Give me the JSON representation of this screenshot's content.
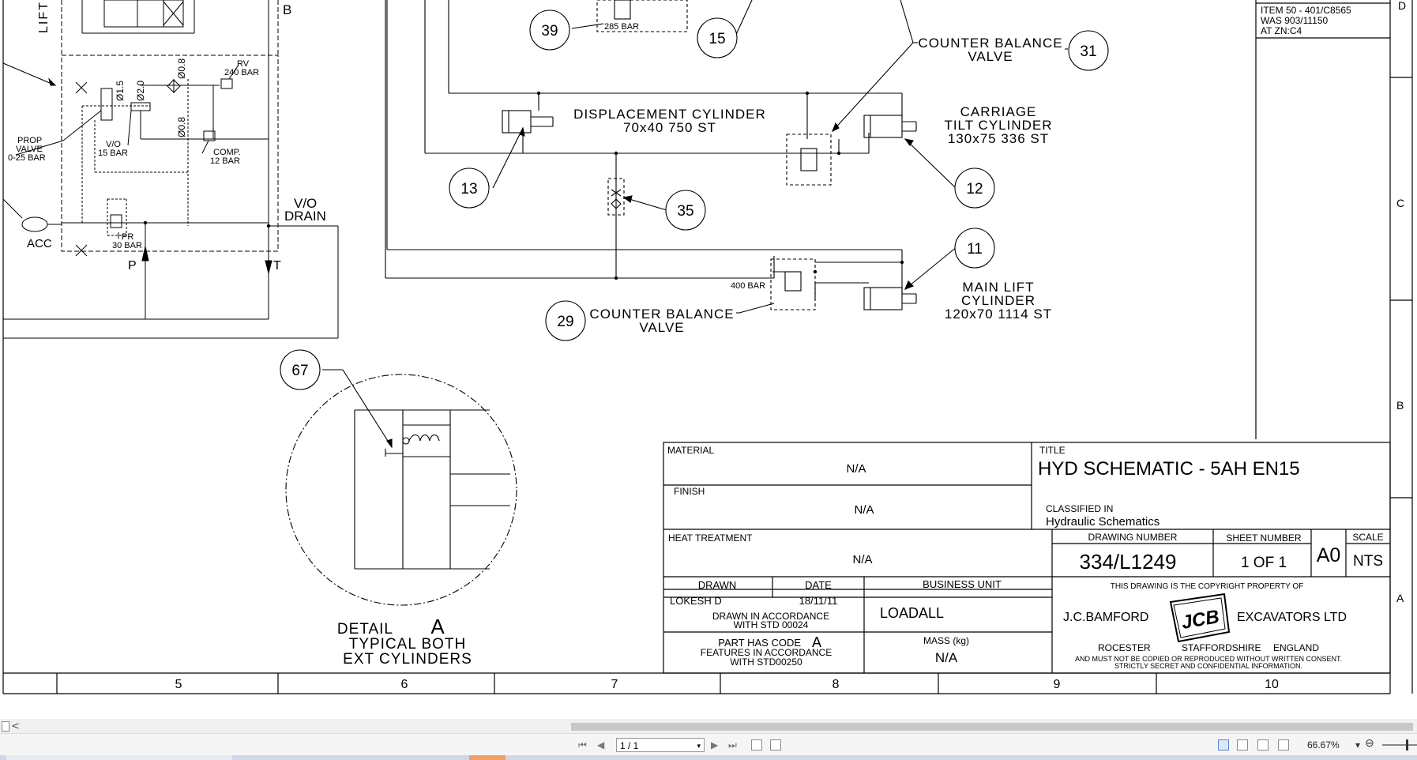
{
  "schematic": {
    "labels": {
      "lift": "LIFT",
      "b_marker": "B",
      "rv": "RV",
      "rv_pressure": "240 BAR",
      "phi15": "Ø1.5",
      "phi20": "Ø2.0",
      "phi08_a": "Ø0.8",
      "phi08_b": "Ø0.8",
      "prop_valve_1": "PROP",
      "prop_valve_2": "VALVE",
      "prop_valve_3": "0-25 BAR",
      "vo_1": "V/O",
      "vo_2": "15 BAR",
      "comp_1": "COMP.",
      "comp_2": "12 BAR",
      "acc": "ACC",
      "pr_1": "PR",
      "pr_2": "30 BAR",
      "p_port": "P",
      "t_port": "T",
      "vo_drain_1": "V/O",
      "vo_drain_2": "DRAIN",
      "bar285": "285 BAR",
      "bar400": "400 BAR",
      "displacement_1": "DISPLACEMENT CYLINDER",
      "displacement_2": "70x40 750 ST",
      "counter_top_1": "COUNTER BALANCE",
      "counter_top_2": "VALVE",
      "tilt_1": "CARRIAGE",
      "tilt_2": "TILT CYLINDER",
      "tilt_3": "130x75 336 ST",
      "lift_cyl_1": "MAIN LIFT",
      "lift_cyl_2": "CYLINDER",
      "lift_cyl_3": "120x70 1114 ST",
      "counter_bot_1": "COUNTER BALANCE",
      "counter_bot_2": "VALVE",
      "detail_1": "DETAIL",
      "detail_letter": "A",
      "detail_2": "TYPICAL BOTH",
      "detail_3": "EXT CYLINDERS"
    },
    "balloons": {
      "b39": "39",
      "b15": "15",
      "b31": "31",
      "b13": "13",
      "b35": "35",
      "b12": "12",
      "b11": "11",
      "b29": "29",
      "b67": "67"
    },
    "revision_block": {
      "line1": "ITEM 50 - 401/C8565",
      "line2": "WAS 903/11150",
      "line3": "AT ZN:C4"
    },
    "zone_rows": {
      "d": "D",
      "c": "C",
      "b": "B",
      "a": "A"
    },
    "zone_columns": [
      "5",
      "6",
      "7",
      "8",
      "9",
      "10"
    ]
  },
  "title_block": {
    "material_label": "MATERIAL",
    "material_value": "N/A",
    "finish_label": "FINISH",
    "finish_value": "N/A",
    "heat_label": "HEAT TREATMENT",
    "heat_value": "N/A",
    "title_label": "TITLE",
    "title_value": "HYD SCHEMATIC - 5AH EN15",
    "classified_label": "CLASSIFIED IN",
    "classified_value": "Hydraulic Schematics",
    "drawing_number_label": "DRAWING NUMBER",
    "drawing_number_value": "334/L1249",
    "sheet_number_label": "SHEET NUMBER",
    "sheet_number_value": "1 OF 1",
    "size": "A0",
    "scale_label": "SCALE",
    "scale_value": "NTS",
    "drawn_label": "DRAWN",
    "drawn_value": "LOKESH D",
    "date_label": "DATE",
    "date_value": "18/11/11",
    "business_unit_label": "BUSINESS UNIT",
    "business_unit_value": "LOADALL",
    "drawn_std_1": "DRAWN IN ACCORDANCE",
    "drawn_std_2": "WITH STD 00024",
    "code_1": "PART HAS CODE",
    "code_letter": "A",
    "code_2": "FEATURES IN ACCORDANCE",
    "code_3": "WITH STD00250",
    "mass_label": "MASS (kg)",
    "mass_value": "N/A",
    "copyright": "THIS DRAWING IS THE COPYRIGHT PROPERTY OF",
    "company_left": "J.C.BAMFORD",
    "company_right": "EXCAVATORS LTD",
    "logo_text": "JCB",
    "town": "ROCESTER",
    "county": "STAFFORDSHIRE",
    "country": "ENGLAND",
    "notice_1": "AND MUST NOT BE COPIED OR REPRODUCED WITHOUT WRITTEN CONSENT.",
    "notice_2": "STRICTLY SECRET AND CONFIDENTIAL INFORMATION."
  },
  "viewer": {
    "scroll_left": "<",
    "page_indicator": "1 / 1",
    "zoom": "66.67%",
    "zoom_out": "⊖",
    "nav_first": "⏮",
    "nav_prev": "◀",
    "nav_next": "▶",
    "nav_last": "⏭",
    "caret": "▾",
    "dropdown": "▾"
  }
}
